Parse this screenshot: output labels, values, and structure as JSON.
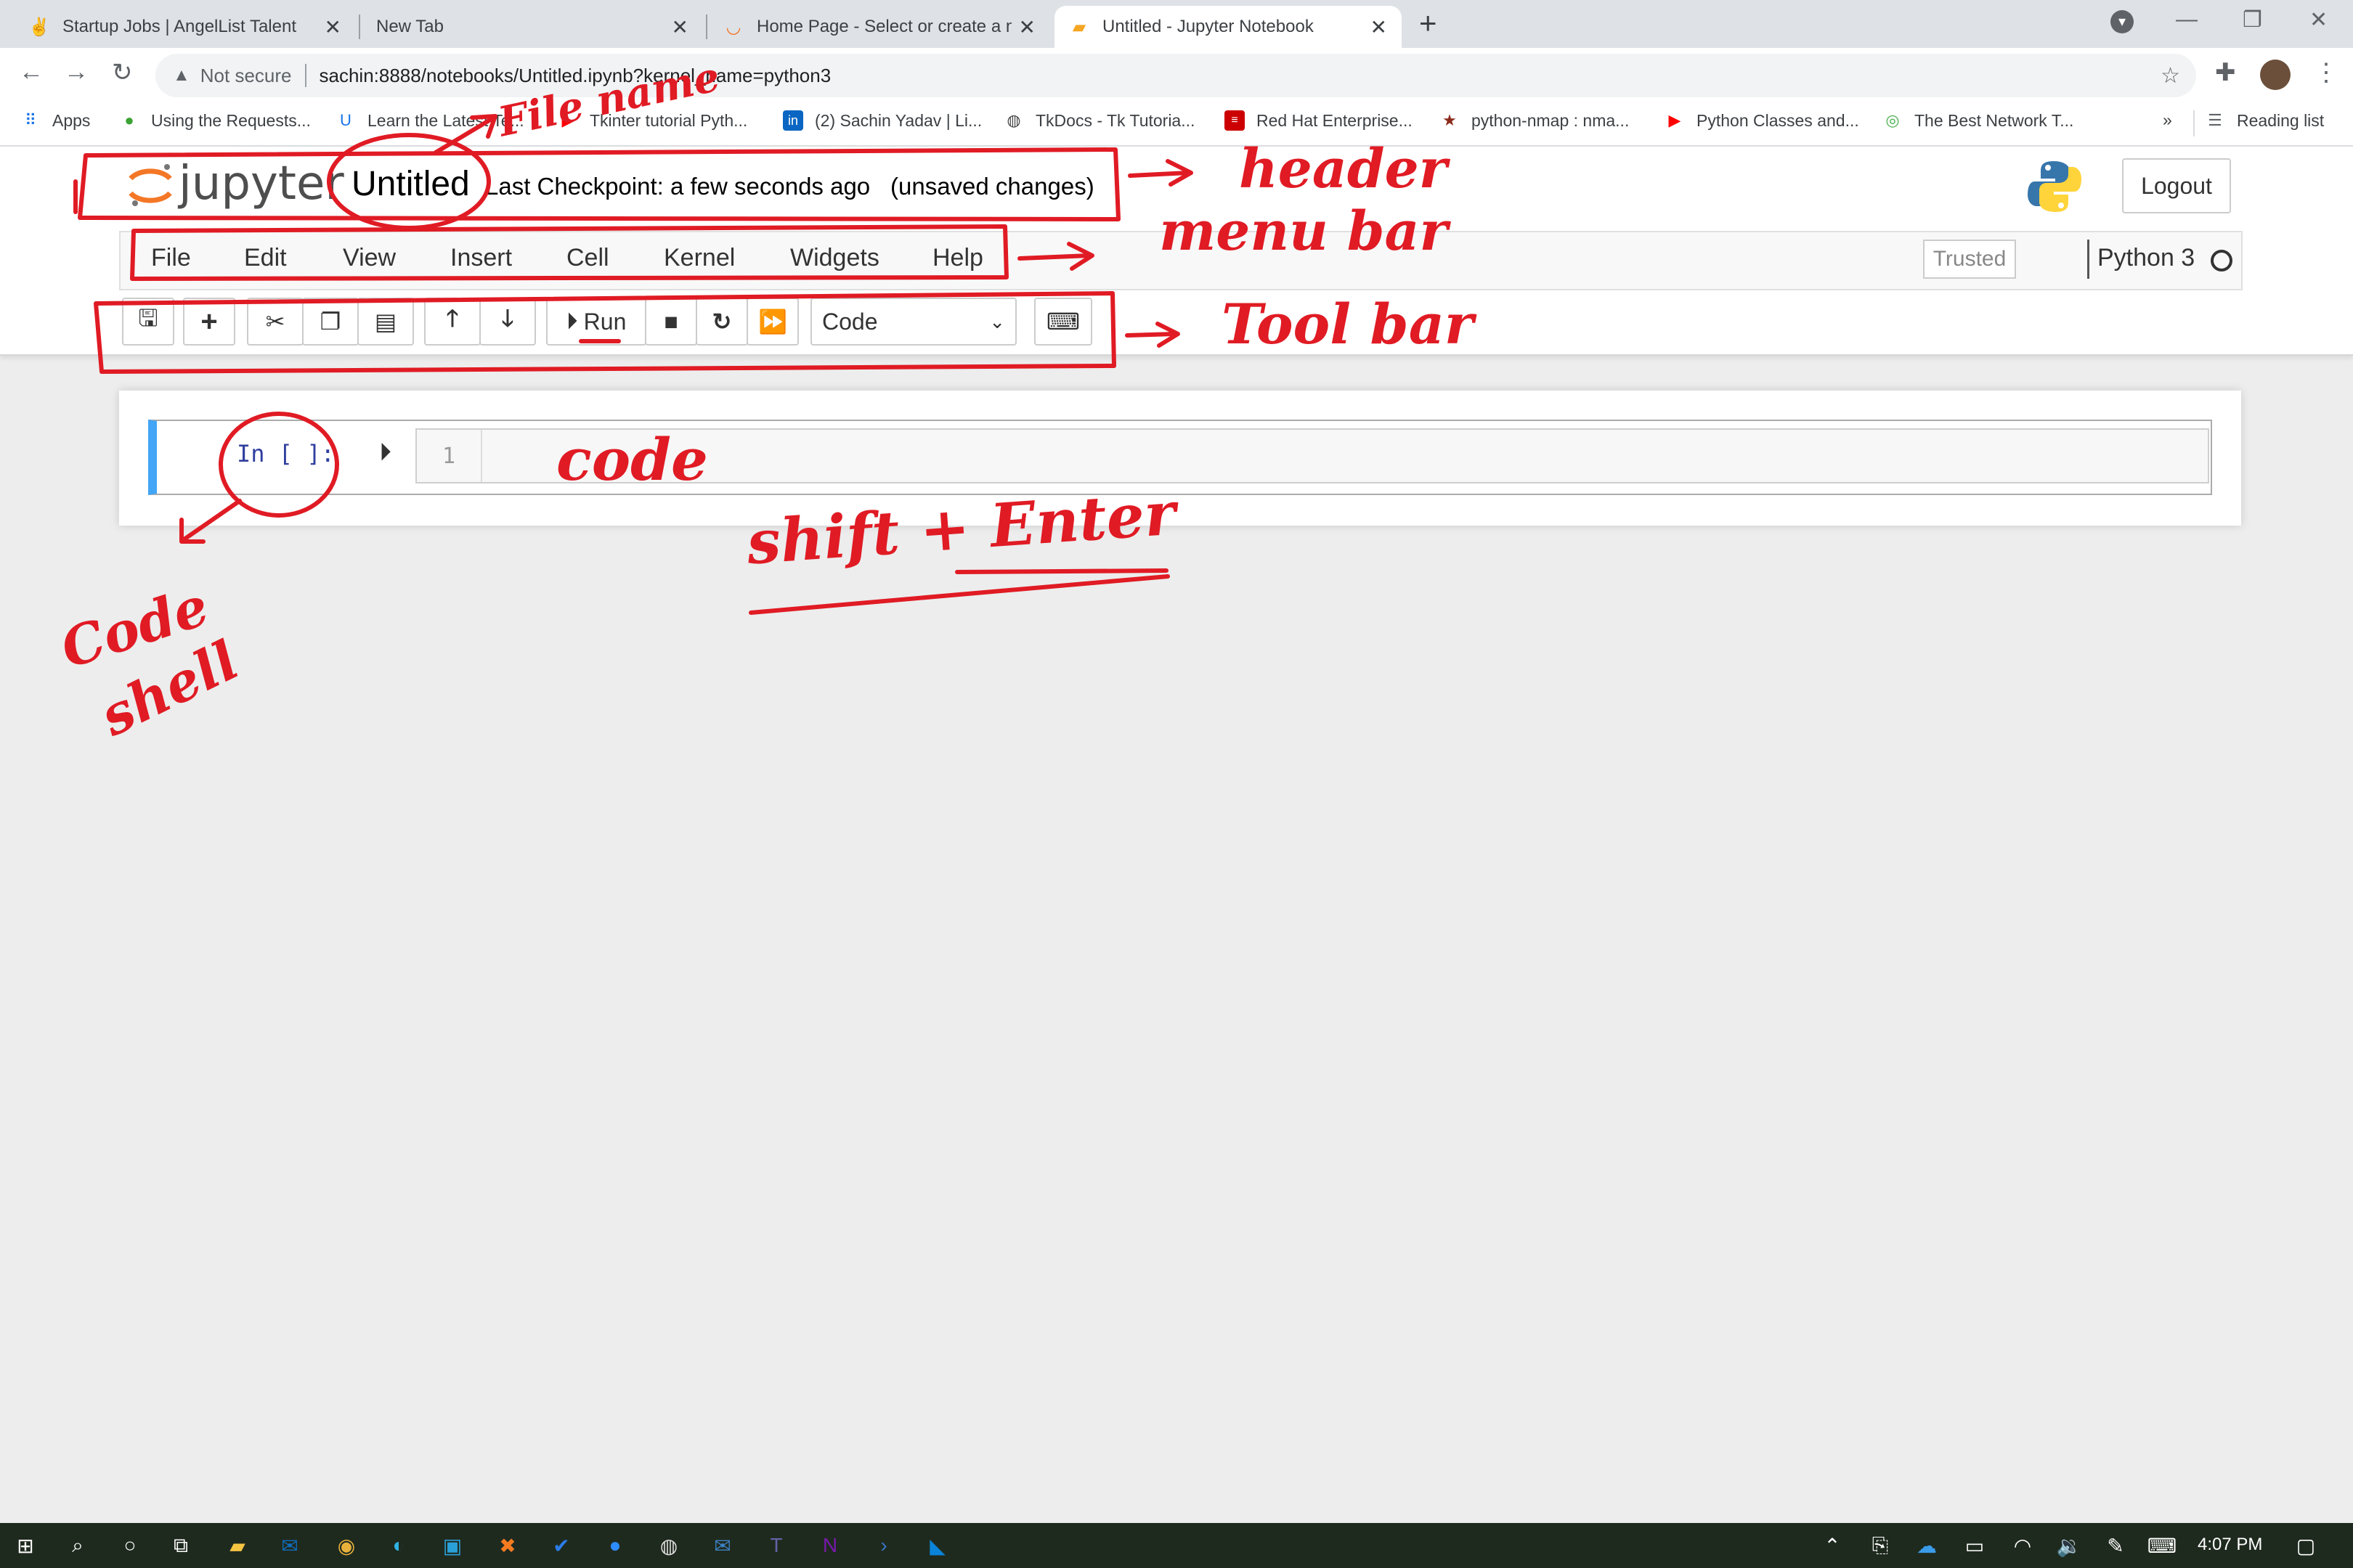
{
  "browser": {
    "tabs": [
      {
        "label": "Startup Jobs | AngelList Talent",
        "icon": "angellist-icon"
      },
      {
        "label": "New Tab",
        "icon": "none"
      },
      {
        "label": "Home Page - Select or create a n",
        "icon": "jupyter-icon"
      },
      {
        "label": "Untitled - Jupyter Notebook",
        "icon": "notebook-icon",
        "active": true
      }
    ],
    "security_label": "Not secure",
    "url": "sachin:8888/notebooks/Untitled.ipynb?kernel_name=python3",
    "bookmarks": [
      {
        "label": "Apps",
        "icon": "apps-grid-icon"
      },
      {
        "label": "Using the Requests...",
        "icon": "leaf-icon"
      },
      {
        "label": "Learn the Latest Te...",
        "icon": "udemy-icon"
      },
      {
        "label": "Tkinter tutorial Pyth...",
        "icon": "youtube-icon"
      },
      {
        "label": "(2) Sachin Yadav | Li...",
        "icon": "linkedin-icon"
      },
      {
        "label": "TkDocs - Tk Tutoria...",
        "icon": "globe-icon"
      },
      {
        "label": "Red Hat Enterprise...",
        "icon": "redhat-icon"
      },
      {
        "label": "python-nmap : nma...",
        "icon": "star-icon"
      },
      {
        "label": "Python Classes and...",
        "icon": "youtube-icon"
      },
      {
        "label": "The Best Network T...",
        "icon": "refresh-green-icon"
      }
    ],
    "more_bookmarks": "»",
    "reading_list": "Reading list"
  },
  "jupyter": {
    "logo_text": "jupyter",
    "notebook_name": "Untitled",
    "checkpoint": "Last Checkpoint: a few seconds ago",
    "unsaved": "(unsaved changes)",
    "logout": "Logout",
    "menu": [
      "File",
      "Edit",
      "View",
      "Insert",
      "Cell",
      "Kernel",
      "Widgets",
      "Help"
    ],
    "trusted": "Trusted",
    "kernel": "Python 3",
    "run_label": "Run",
    "cell_type": "Code",
    "cell_prompt": "In [ ]:",
    "line_number": "1"
  },
  "annotations": {
    "file_name": "File name",
    "header": "header",
    "menu_bar": "menu bar",
    "tool_bar": "Tool bar",
    "code": "code",
    "shift_enter": "shift + Enter",
    "code_shell_1": "Code",
    "code_shell_2": "shell"
  },
  "taskbar": {
    "time": "4:07 PM"
  }
}
